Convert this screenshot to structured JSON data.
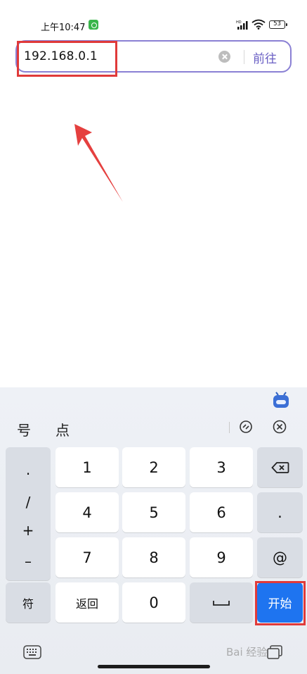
{
  "status_bar": {
    "time": "上午10:47",
    "battery": "53",
    "network_label": "HD"
  },
  "address_bar": {
    "value": "192.168.0.1",
    "go_label": "前往"
  },
  "keyboard": {
    "candidates": [
      "号",
      "点"
    ],
    "side_symbols": [
      "·",
      "/",
      "+",
      "–"
    ],
    "digits": [
      "1",
      "2",
      "3",
      "4",
      "5",
      "6",
      "7",
      "8",
      "9"
    ],
    "right_col": {
      "dot": ".",
      "at": "@"
    },
    "bottom": {
      "symbols_label": "符",
      "back_label": "返回",
      "zero_label": "0",
      "enter_label": "开始"
    },
    "watermark": "Bai 经验"
  },
  "colors": {
    "accent": "#6a5fc4",
    "border": "#8a80d4",
    "enter": "#1e74f0",
    "highlight": "#e03a3a"
  }
}
